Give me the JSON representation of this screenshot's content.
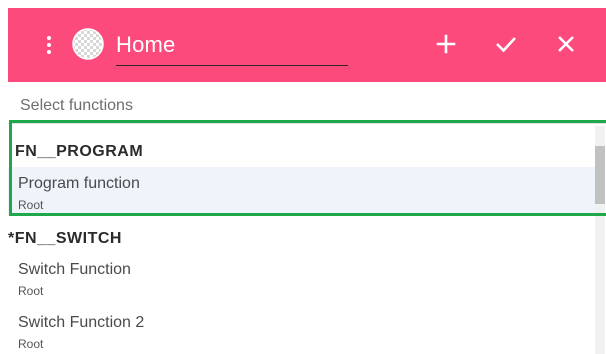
{
  "toolbar": {
    "title": "Home",
    "icons": {
      "more": "more-vert-icon",
      "logo": "checkered-globe-icon",
      "add": "plus-icon",
      "confirm": "check-icon",
      "close": "close-icon"
    }
  },
  "search": {
    "placeholder": "Select functions",
    "value": ""
  },
  "groups": [
    {
      "header": "FN__PROGRAM",
      "items": [
        {
          "name": "Program function",
          "sub": "Root",
          "selected": true
        }
      ]
    },
    {
      "header": "*FN__SWITCH",
      "items": [
        {
          "name": "Switch Function",
          "sub": "Root"
        },
        {
          "name": "Switch Function 2",
          "sub": "Root"
        }
      ]
    }
  ],
  "colors": {
    "toolbar_bg": "#fc4a7d",
    "highlight_border": "#1ea84a",
    "selected_bg": "#eef4fa"
  }
}
